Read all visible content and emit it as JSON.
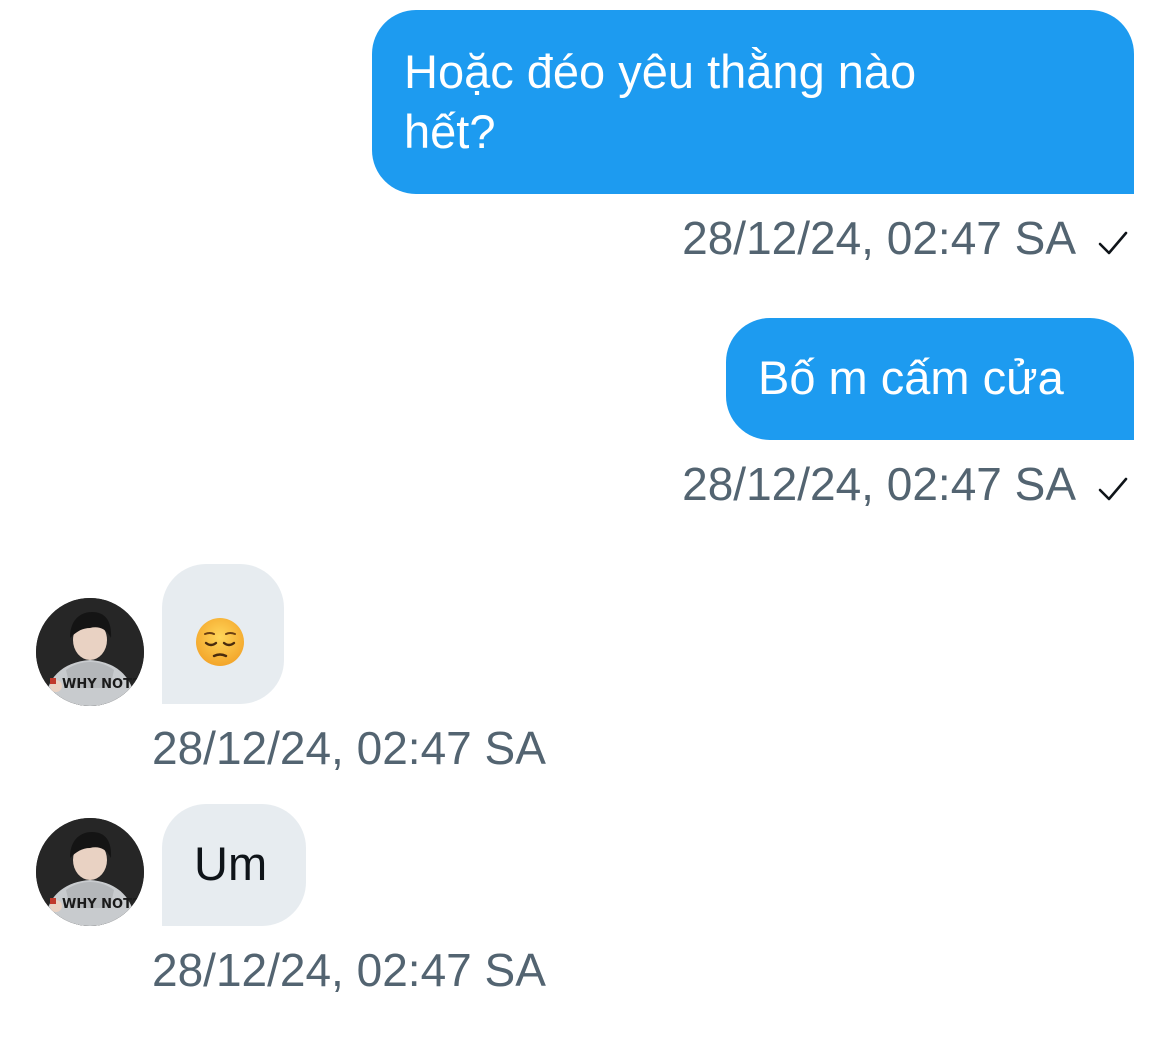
{
  "conversation": {
    "messages": [
      {
        "direction": "outgoing",
        "text": "Hoặc đéo yêu thằng nào hết?",
        "line1": "Hoặc đéo yêu thằng nào",
        "line2": "hết?",
        "timestamp": "28/12/24, 02:47 SA",
        "status_icon": "check-icon"
      },
      {
        "direction": "outgoing",
        "text": "Bố m cấm cửa",
        "timestamp": "28/12/24, 02:47 SA",
        "status_icon": "check-icon"
      },
      {
        "direction": "incoming",
        "text": "😔",
        "emoji_name": "pensive-face-emoji",
        "timestamp": "28/12/24, 02:47 SA",
        "avatar_icon": "avatar"
      },
      {
        "direction": "incoming",
        "text": "Um",
        "timestamp": "28/12/24, 02:47 SA",
        "avatar_icon": "avatar"
      }
    ]
  },
  "colors": {
    "outgoing_bubble": "#1d9bf0",
    "incoming_bubble": "#e7ecf0",
    "timestamp_text": "#536471",
    "incoming_text": "#0f1419"
  }
}
